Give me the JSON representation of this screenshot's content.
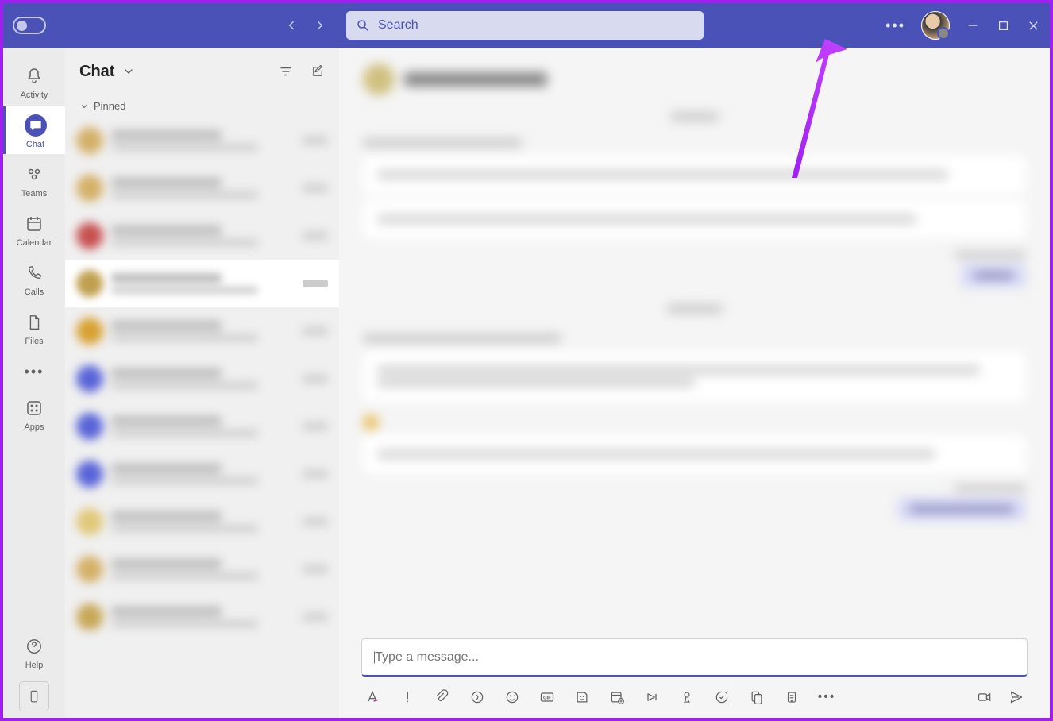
{
  "titlebar": {
    "search_placeholder": "Search"
  },
  "rail": {
    "activity": "Activity",
    "chat": "Chat",
    "teams": "Teams",
    "calendar": "Calendar",
    "calls": "Calls",
    "files": "Files",
    "apps": "Apps",
    "help": "Help"
  },
  "chatlist": {
    "title": "Chat",
    "pinned": "Pinned"
  },
  "compose": {
    "placeholder": "Type a message...",
    "caret": "|"
  },
  "avatars": {
    "colors": [
      "#d4b068",
      "#d4b068",
      "#c85050",
      "#c0a050",
      "#d8a030",
      "#5864d8",
      "#5864d8",
      "#5864d8",
      "#e0c878",
      "#d4b068",
      "#c8a858"
    ]
  }
}
